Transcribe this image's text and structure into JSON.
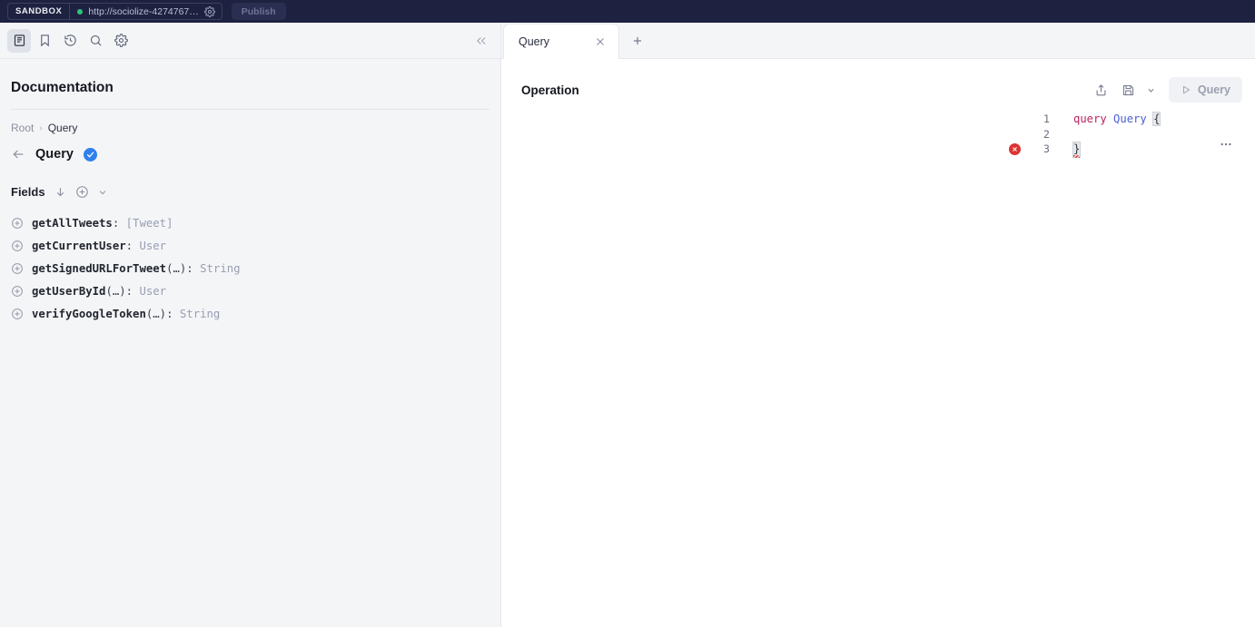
{
  "topbar": {
    "sandbox_label": "SANDBOX",
    "url": "http://sociolize-4274767…",
    "status_dot_color": "#2fc27a",
    "settings_icon": "gear-icon",
    "publish_label": "Publish",
    "background_color": "#1e2240"
  },
  "docs": {
    "toolbar": [
      {
        "name": "documentation-icon",
        "active": true
      },
      {
        "name": "bookmark-icon",
        "active": false
      },
      {
        "name": "history-icon",
        "active": false
      },
      {
        "name": "search-icon",
        "active": false
      },
      {
        "name": "gear-icon",
        "active": false
      }
    ],
    "collapse_icon": "chevron-double-left-icon",
    "title": "Documentation",
    "breadcrumb": {
      "root": "Root",
      "separator": "›",
      "current": "Query"
    },
    "type_name": "Query",
    "type_badge_color": "#2f80ed",
    "fields_label": "Fields",
    "fields": [
      {
        "name": "getAllTweets",
        "args": "",
        "type": "[Tweet]"
      },
      {
        "name": "getCurrentUser",
        "args": "",
        "type": "User"
      },
      {
        "name": "getSignedURLForTweet",
        "args": "(…)",
        "type": "String"
      },
      {
        "name": "getUserById",
        "args": "(…)",
        "type": "User"
      },
      {
        "name": "verifyGoogleToken",
        "args": "(…)",
        "type": "String"
      }
    ]
  },
  "tabs": {
    "items": [
      {
        "label": "Query",
        "active": true
      }
    ],
    "close_icon": "close-icon",
    "new_tab_icon": "plus-icon"
  },
  "operation": {
    "title": "Operation",
    "share_icon": "share-icon",
    "save_icon": "save-icon",
    "save_caret_icon": "chevron-down-icon",
    "run_label": "Query",
    "run_icon": "play-icon",
    "more_icon": "more-horizontal-icon"
  },
  "editor": {
    "lines": [
      {
        "number": "1",
        "tokens": [
          {
            "text": "query ",
            "cls": "kw-query"
          },
          {
            "text": "Query",
            "cls": "kw-name"
          },
          {
            "text": " ",
            "cls": ""
          },
          {
            "text": "{",
            "cls": "brace"
          }
        ],
        "error": false
      },
      {
        "number": "2",
        "tokens": [],
        "error": false
      },
      {
        "number": "3",
        "tokens": [
          {
            "text": "}",
            "cls": "brace-err"
          }
        ],
        "error": true
      }
    ],
    "error_icon": "error-circle-icon",
    "error_color": "#dd3434"
  }
}
